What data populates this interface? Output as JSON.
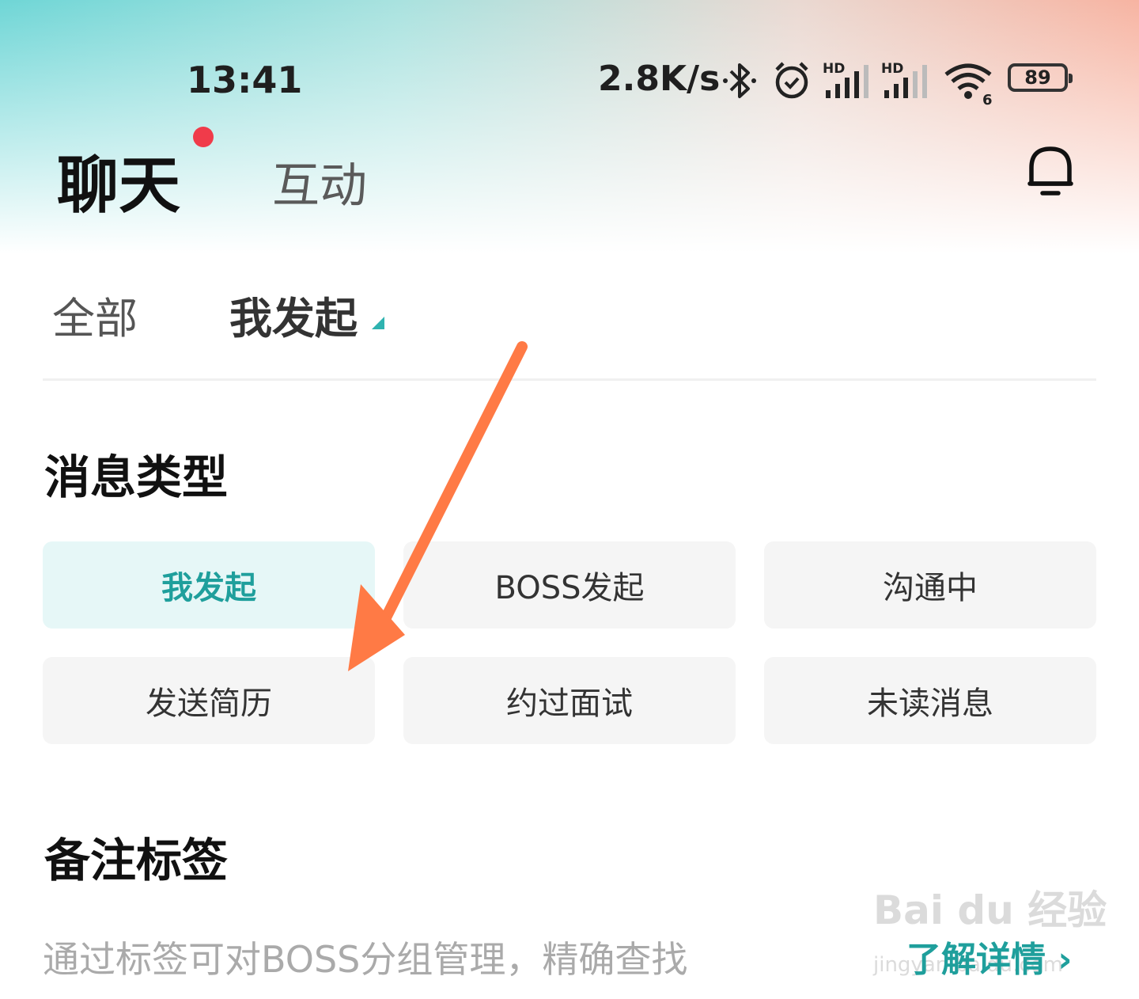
{
  "status_bar": {
    "time": "13:41",
    "net_speed": "2.8K/s",
    "battery": "89",
    "hd1": "HD",
    "hd2": "HD",
    "wifi_num": "6",
    "icons": [
      "bluetooth-icon",
      "alarm-icon",
      "signal-icon",
      "signal-icon",
      "wifi-icon",
      "battery-icon"
    ]
  },
  "header": {
    "tabs": [
      {
        "label": "聊天",
        "active": true
      },
      {
        "label": "互动",
        "active": false
      }
    ],
    "bell_icon": "bell-icon"
  },
  "filters": {
    "tabs": [
      {
        "label": "全部",
        "active": false
      },
      {
        "label": "我发起",
        "active": true
      }
    ]
  },
  "message_types": {
    "title": "消息类型",
    "chips": [
      {
        "label": "我发起",
        "selected": true
      },
      {
        "label": "BOSS发起",
        "selected": false
      },
      {
        "label": "沟通中",
        "selected": false
      },
      {
        "label": "发送简历",
        "selected": false
      },
      {
        "label": "约过面试",
        "selected": false
      },
      {
        "label": "未读消息",
        "selected": false
      }
    ]
  },
  "note_tags": {
    "title": "备注标签",
    "hint": "通过标签可对BOSS分组管理，精确查找",
    "detail_link": "了解详情"
  },
  "watermark": {
    "brand": "Bai du 经验",
    "url": "jingyan.baidu.com"
  },
  "colors": {
    "accent": "#1f9f9c",
    "selected_chip_bg": "#e6f7f7",
    "chip_bg": "#f5f5f5",
    "red_dot": "#f03b4a",
    "annotation_arrow": "#ff7a45"
  }
}
